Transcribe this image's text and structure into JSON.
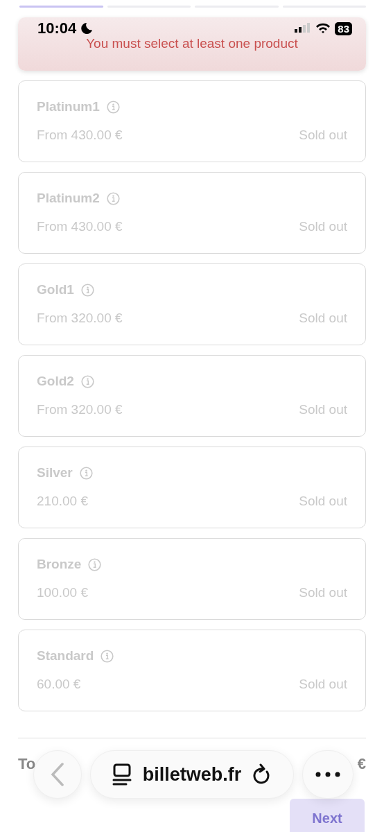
{
  "steps": [
    {
      "selected": true
    },
    {
      "selected": false
    },
    {
      "selected": false
    },
    {
      "selected": false
    }
  ],
  "status_bar": {
    "time": "10:04",
    "battery": "83"
  },
  "toast": {
    "message": "You must select at least one product"
  },
  "products": [
    {
      "name": "Platinum1",
      "price": "From 430.00 €",
      "status": "Sold out",
      "disabled": true
    },
    {
      "name": "Platinum2",
      "price": "From 430.00 €",
      "status": "Sold out",
      "disabled": true
    },
    {
      "name": "Gold1",
      "price": "From 320.00 €",
      "status": "Sold out",
      "disabled": true
    },
    {
      "name": "Gold2",
      "price": "From 320.00 €",
      "status": "Sold out",
      "disabled": true
    },
    {
      "name": "Silver",
      "price": "210.00 €",
      "status": "Sold out",
      "disabled": true
    },
    {
      "name": "Bronze",
      "price": "100.00 €",
      "status": "Sold out",
      "disabled": true
    },
    {
      "name": "Standard",
      "price": "60.00 €",
      "status": "Sold out",
      "disabled": true
    }
  ],
  "total": {
    "label": "To",
    "value": "€"
  },
  "next_button": {
    "label": "Next",
    "disabled": true
  },
  "browser_bar": {
    "url": "billetweb.fr"
  }
}
